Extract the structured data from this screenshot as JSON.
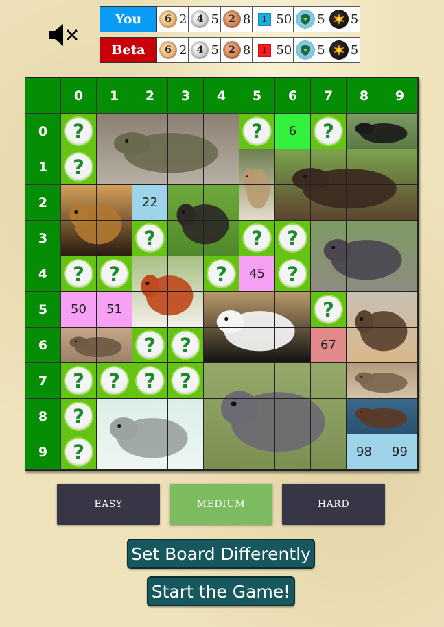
{
  "audio": {
    "icon": "speaker-muted-icon"
  },
  "players": [
    {
      "id": "you",
      "name": "You",
      "color": "#0a9cf5",
      "gold": "2",
      "silver": "5",
      "bronze": "8",
      "flag_label": "1",
      "flag_color": "#19aee6",
      "flag_count": "50",
      "shield": "5",
      "bomb": "5"
    },
    {
      "id": "beta",
      "name": "Beta",
      "color": "#c8000a",
      "gold": "2",
      "silver": "5",
      "bronze": "8",
      "flag_label": "1",
      "flag_color": "#ff1a1a",
      "flag_count": "50",
      "shield": "5",
      "bomb": "5"
    }
  ],
  "coin_labels": {
    "gold": "6",
    "silver": "4",
    "bronze": "2"
  },
  "board": {
    "columns": [
      "0",
      "1",
      "2",
      "3",
      "4",
      "5",
      "6",
      "7",
      "8",
      "9"
    ],
    "rows": [
      "0",
      "1",
      "2",
      "3",
      "4",
      "5",
      "6",
      "7",
      "8",
      "9"
    ],
    "mystery_symbol": "?",
    "mystery_cells": [
      [
        0,
        0
      ],
      [
        0,
        5
      ],
      [
        0,
        7
      ],
      [
        1,
        0
      ],
      [
        3,
        2
      ],
      [
        3,
        5
      ],
      [
        3,
        6
      ],
      [
        4,
        0
      ],
      [
        4,
        1
      ],
      [
        4,
        4
      ],
      [
        4,
        6
      ],
      [
        5,
        7
      ],
      [
        6,
        2
      ],
      [
        6,
        3
      ],
      [
        7,
        0
      ],
      [
        7,
        1
      ],
      [
        7,
        2
      ],
      [
        7,
        3
      ],
      [
        8,
        0
      ],
      [
        9,
        0
      ]
    ],
    "number_cells": [
      {
        "row": 0,
        "col": 6,
        "label": "6",
        "style": "n-green"
      },
      {
        "row": 2,
        "col": 2,
        "label": "22",
        "style": "n-blue"
      },
      {
        "row": 4,
        "col": 5,
        "label": "45",
        "style": "n-pink"
      },
      {
        "row": 5,
        "col": 0,
        "label": "50",
        "style": "n-pink"
      },
      {
        "row": 5,
        "col": 1,
        "label": "51",
        "style": "n-pink"
      },
      {
        "row": 6,
        "col": 7,
        "label": "67",
        "style": "n-red"
      },
      {
        "row": 9,
        "col": 8,
        "label": "98",
        "style": "n-blue"
      },
      {
        "row": 9,
        "col": 9,
        "label": "99",
        "style": "n-blue"
      }
    ],
    "animals": [
      {
        "name": "rhinoceros",
        "row": 0,
        "col": 1,
        "rows": 2,
        "cols": 4
      },
      {
        "name": "tasmanian-devil",
        "row": 0,
        "col": 8,
        "rows": 1,
        "cols": 2
      },
      {
        "name": "lynx",
        "row": 1,
        "col": 5,
        "rows": 2,
        "cols": 1
      },
      {
        "name": "bison",
        "row": 1,
        "col": 6,
        "rows": 2,
        "cols": 4
      },
      {
        "name": "leopard",
        "row": 2,
        "col": 0,
        "rows": 2,
        "cols": 2
      },
      {
        "name": "chimpanzee",
        "row": 2,
        "col": 3,
        "rows": 2,
        "cols": 2
      },
      {
        "name": "hippopotamus",
        "row": 3,
        "col": 7,
        "rows": 2,
        "cols": 3
      },
      {
        "name": "red-panda",
        "row": 4,
        "col": 2,
        "rows": 2,
        "cols": 2
      },
      {
        "name": "giant-panda",
        "row": 5,
        "col": 4,
        "rows": 2,
        "cols": 3
      },
      {
        "name": "african-wild-dog",
        "row": 5,
        "col": 8,
        "rows": 2,
        "cols": 2
      },
      {
        "name": "tortoise",
        "row": 6,
        "col": 0,
        "rows": 1,
        "cols": 2
      },
      {
        "name": "elephant",
        "row": 7,
        "col": 4,
        "rows": 3,
        "cols": 4
      },
      {
        "name": "meerkat",
        "row": 7,
        "col": 8,
        "rows": 1,
        "cols": 2
      },
      {
        "name": "seal",
        "row": 8,
        "col": 1,
        "rows": 2,
        "cols": 3
      },
      {
        "name": "otter",
        "row": 8,
        "col": 8,
        "rows": 1,
        "cols": 2
      }
    ]
  },
  "difficulty": {
    "options": [
      "EASY",
      "MEDIUM",
      "HARD"
    ],
    "selected": "MEDIUM"
  },
  "actions": {
    "set_board": "Set Board Differently",
    "start": "Start the Game!"
  }
}
